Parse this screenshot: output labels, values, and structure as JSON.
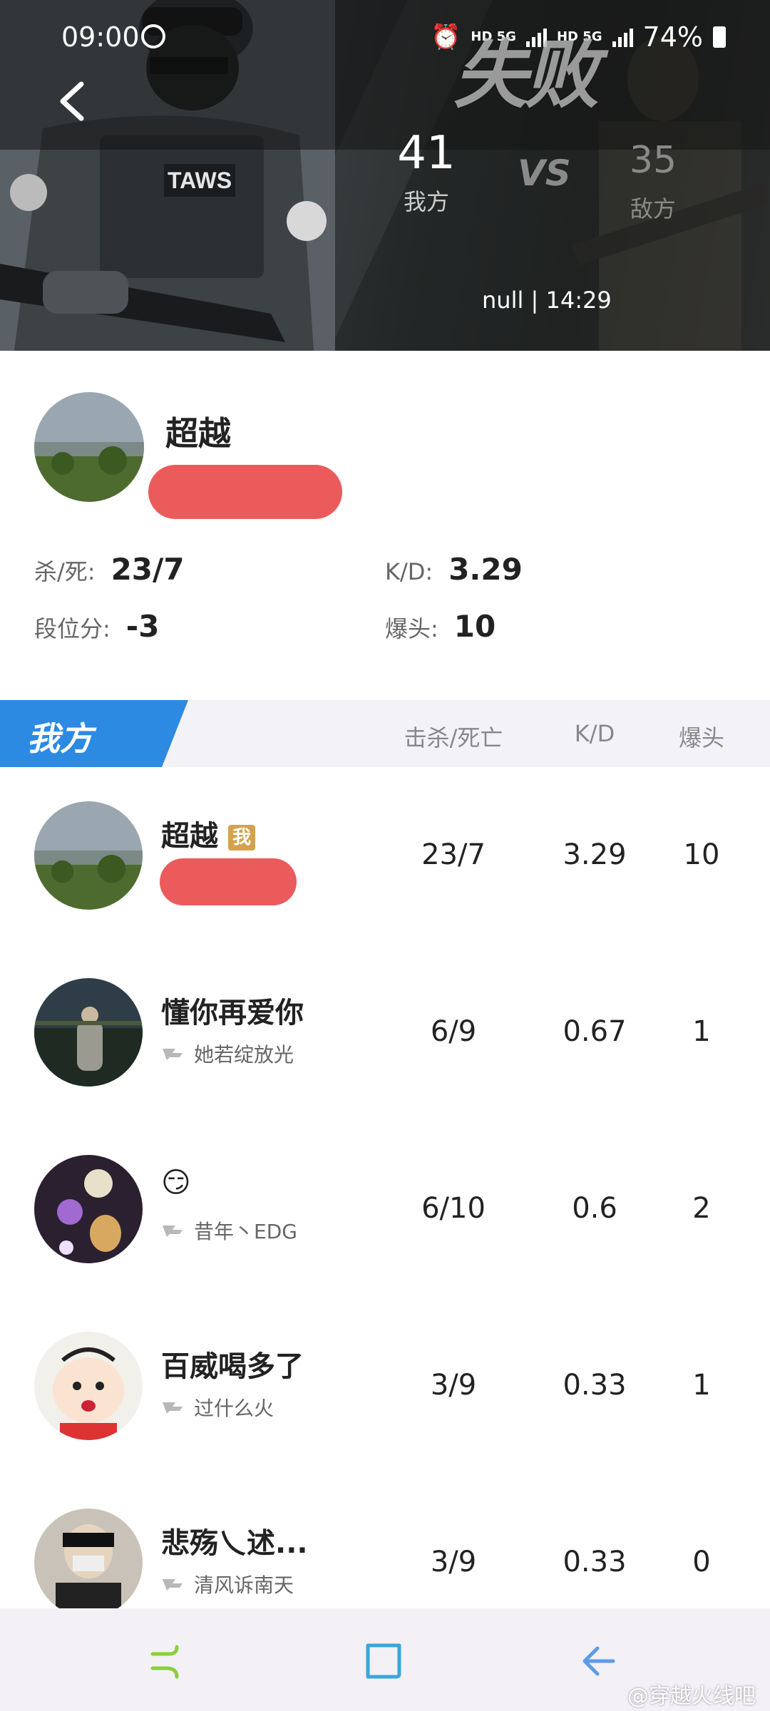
{
  "status_bar": {
    "time": "09:00",
    "network1": "HD 5G",
    "network2": "HD 5G",
    "battery": "74%"
  },
  "match": {
    "result": "失败",
    "our_score": "41",
    "our_label": "我方",
    "vs": "VS",
    "enemy_score": "35",
    "enemy_label": "敌方",
    "meta": "null | 14:29"
  },
  "player": {
    "name": "超越",
    "kd_label": "杀/死:",
    "kd_value": "23/7",
    "ratio_label": "K/D:",
    "ratio_value": "3.29",
    "rank_label": "段位分:",
    "rank_value": "-3",
    "headshot_label": "爆头:",
    "headshot_value": "10"
  },
  "team": {
    "tag": "我方",
    "col_kills": "击杀/死亡",
    "col_kd": "K/D",
    "col_hs": "爆头",
    "me_badge": "我",
    "rows": [
      {
        "name": "超越",
        "sub": "",
        "kills": "23/7",
        "kd": "3.29",
        "hs": "10"
      },
      {
        "name": "懂你再爱你",
        "sub": "她若绽放光",
        "kills": "6/9",
        "kd": "0.67",
        "hs": "1"
      },
      {
        "name": "😏",
        "sub": "昔年丶EDG",
        "kills": "6/10",
        "kd": "0.6",
        "hs": "2"
      },
      {
        "name": "百威喝多了",
        "sub": "过什么火",
        "kills": "3/9",
        "kd": "0.33",
        "hs": "1"
      },
      {
        "name": "悲殇乀述...",
        "sub": "清风诉南天",
        "kills": "3/9",
        "kd": "0.33",
        "hs": "0"
      }
    ]
  },
  "watermark": "@穿越火线吧",
  "colors": {
    "accent": "#2d8ae3",
    "redact": "#ec5b5b",
    "badge": "#d4a24c"
  }
}
